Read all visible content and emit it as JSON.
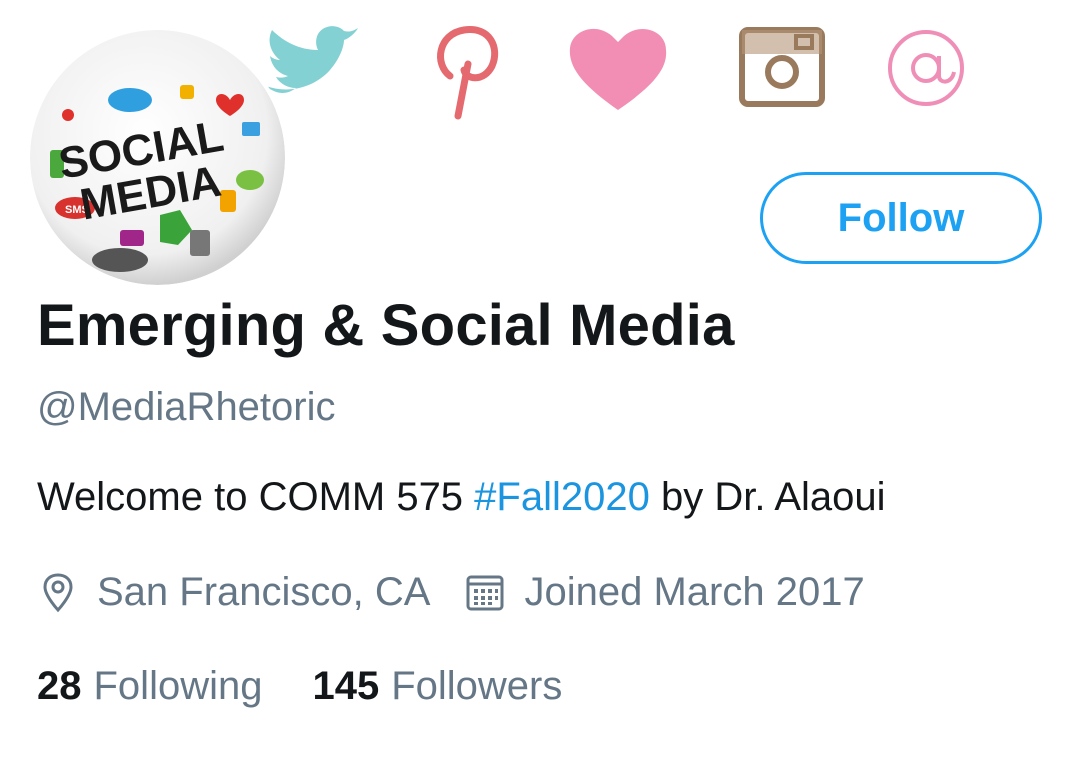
{
  "banner": {
    "icons": [
      "twitter-bird-icon",
      "pinterest-icon",
      "heart-icon",
      "instagram-icon",
      "at-sign-icon"
    ]
  },
  "avatar": {
    "line1": "SOCIAL",
    "line2": "MEDIA",
    "sms": "SMS"
  },
  "profile": {
    "follow_label": "Follow",
    "display_name": "Emerging & Social Media",
    "handle": "@MediaRhetoric",
    "bio_prefix": "Welcome to COMM 575 ",
    "bio_hashtag": "#Fall2020",
    "bio_suffix": " by Dr. Alaoui",
    "location": "San Francisco, CA",
    "joined": "Joined March 2017",
    "following_count": "28",
    "following_label": "Following",
    "followers_count": "145",
    "followers_label": "Followers"
  },
  "colors": {
    "accent": "#1da1f2",
    "hashtag": "#1b95e0",
    "secondary_text": "#657786",
    "primary_text": "#14171a"
  }
}
